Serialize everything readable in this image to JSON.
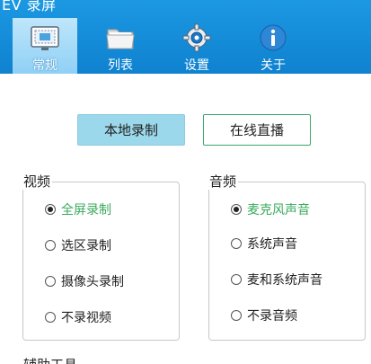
{
  "app": {
    "title": "EV 录屏"
  },
  "tabs": [
    {
      "label": "常规",
      "icon": "screen-capture-icon",
      "active": true
    },
    {
      "label": "列表",
      "icon": "folder-icon",
      "active": false
    },
    {
      "label": "设置",
      "icon": "gear-icon",
      "active": false
    },
    {
      "label": "关于",
      "icon": "info-icon",
      "active": false
    }
  ],
  "mode": {
    "local_label": "本地录制",
    "live_label": "在线直播",
    "selected": "local"
  },
  "video": {
    "title": "视频",
    "options": [
      "全屏录制",
      "选区录制",
      "摄像头录制",
      "不录视频"
    ],
    "selected_index": 0
  },
  "audio": {
    "title": "音频",
    "options": [
      "麦克风声音",
      "系统声音",
      "麦和系统声音",
      "不录音频"
    ],
    "selected_index": 0
  },
  "next_section": {
    "title": "辅助工具"
  },
  "colors": {
    "titlebar": "#1a93de",
    "active_tab": "#a9dcf8",
    "selected_text": "#3aaa5c",
    "live_border": "#39a86a",
    "local_button": "#9bd8ec"
  }
}
